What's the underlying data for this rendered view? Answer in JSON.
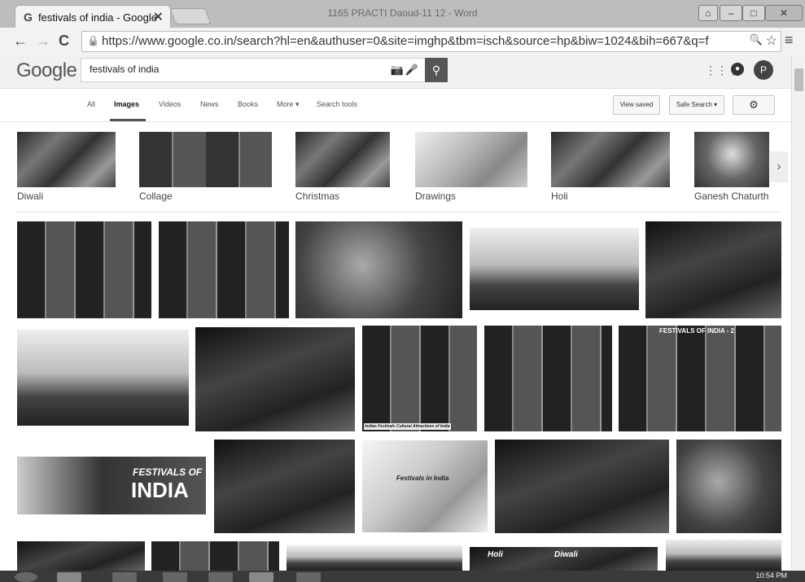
{
  "browser": {
    "tab_title": "festivals of india - Google",
    "tab_close": "✕",
    "window_title": "1165 PRACTI Daoud-11 12 - Word",
    "url": "https://www.google.co.in/search?hl=en&authuser=0&site=imghp&tbm=isch&source=hp&biw=1024&bih=667&q=f",
    "back_icon": "←",
    "forward_icon": "→",
    "reload_icon": "C",
    "zoom_icon": "🔍",
    "star_icon": "☆",
    "menu_icon": "≡"
  },
  "google": {
    "logo": "Google",
    "query": "festivals of india",
    "avatar_letter": "P"
  },
  "menu": {
    "items": [
      "All",
      "Images",
      "Videos",
      "News",
      "Books",
      "More ▾",
      "Search tools"
    ],
    "view_saved": "View saved",
    "safe_search": "Safe Search ▾"
  },
  "related": [
    {
      "label": "Diwali"
    },
    {
      "label": "Collage"
    },
    {
      "label": "Christmas"
    },
    {
      "label": "Drawings"
    },
    {
      "label": "Holi"
    },
    {
      "label": "Ganesh Chaturthi"
    }
  ],
  "overlays": {
    "festivals_of_india_2": "FESTIVALS OF INDIA - 2",
    "indian_festivals_caption": "Indian Festivals Cultural Attractions of India",
    "festivals_of": "FESTIVALS OF",
    "india": "INDIA",
    "festivals_in_india": "Festivals in India",
    "holi": "Holi",
    "diwali": "Diwali"
  },
  "taskbar": {
    "clock": "10:54 PM"
  }
}
